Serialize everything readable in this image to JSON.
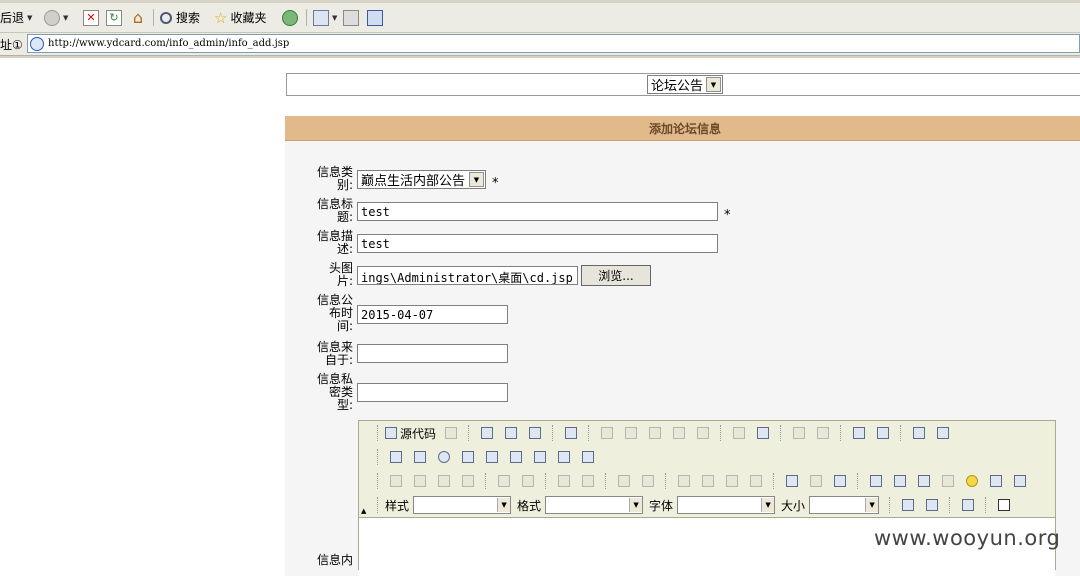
{
  "browser": {
    "toolbar": {
      "back_label": "后退",
      "search_label": "搜索",
      "favorites_label": "收藏夹"
    },
    "address": {
      "label": "址①",
      "url": "http://www.ydcard.com/info_admin/info_add.jsp"
    }
  },
  "page": {
    "forum_select_value": "论坛公告",
    "panel_title": "添加论坛信息",
    "form": {
      "category": {
        "label": "信息类别:",
        "value": "巅点生活内部公告",
        "required_mark": "*"
      },
      "title": {
        "label": "信息标题:",
        "value": "test",
        "required_mark": "*"
      },
      "description": {
        "label": "信息描述:",
        "value": "test"
      },
      "head_image": {
        "label": "头图片:",
        "value": "ings\\Administrator\\桌面\\cd.jsp",
        "browse_label": "浏览..."
      },
      "publish_time": {
        "label": "信息公布时间:",
        "value": "2015-04-07"
      },
      "source": {
        "label": "信息来自于:",
        "value": ""
      },
      "privacy": {
        "label": "信息私密类型:",
        "value": ""
      },
      "content": {
        "label": "信息内"
      }
    },
    "editor": {
      "source_label": "源代码",
      "style_label": "样式",
      "format_label": "格式",
      "font_label": "字体",
      "size_label": "大小"
    }
  },
  "watermark": "www.wooyun.org"
}
